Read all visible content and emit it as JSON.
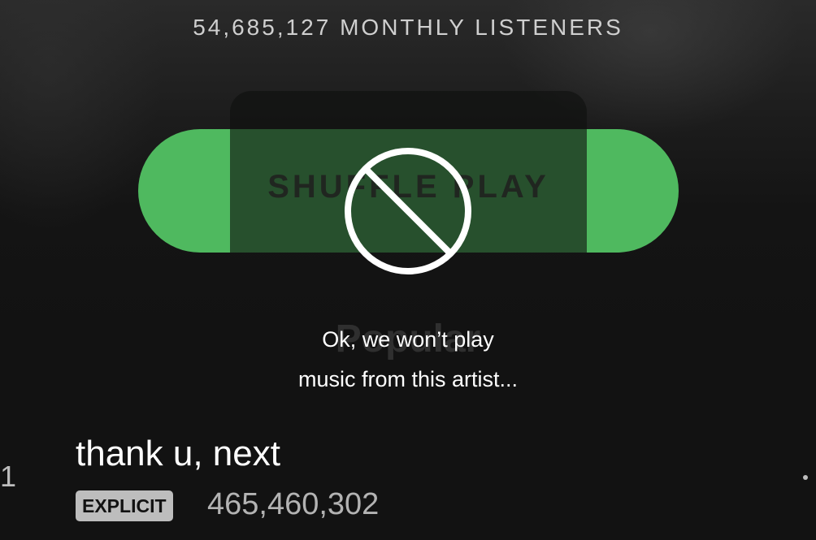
{
  "artist": {
    "monthly_listeners": "54,685,127 MONTHLY LISTENERS"
  },
  "shuffle": {
    "label": "SHUFFLE PLAY"
  },
  "section": {
    "title": "Popular"
  },
  "toast": {
    "line1": "Ok, we won’t play",
    "line2": "music from this artist...",
    "icon": "block-icon"
  },
  "tracks": [
    {
      "number": "1",
      "title": "thank u, next",
      "badge": "EXPLICIT",
      "plays": "465,460,302"
    }
  ],
  "colors": {
    "accent_green": "#4fb95f",
    "background": "#121212"
  }
}
